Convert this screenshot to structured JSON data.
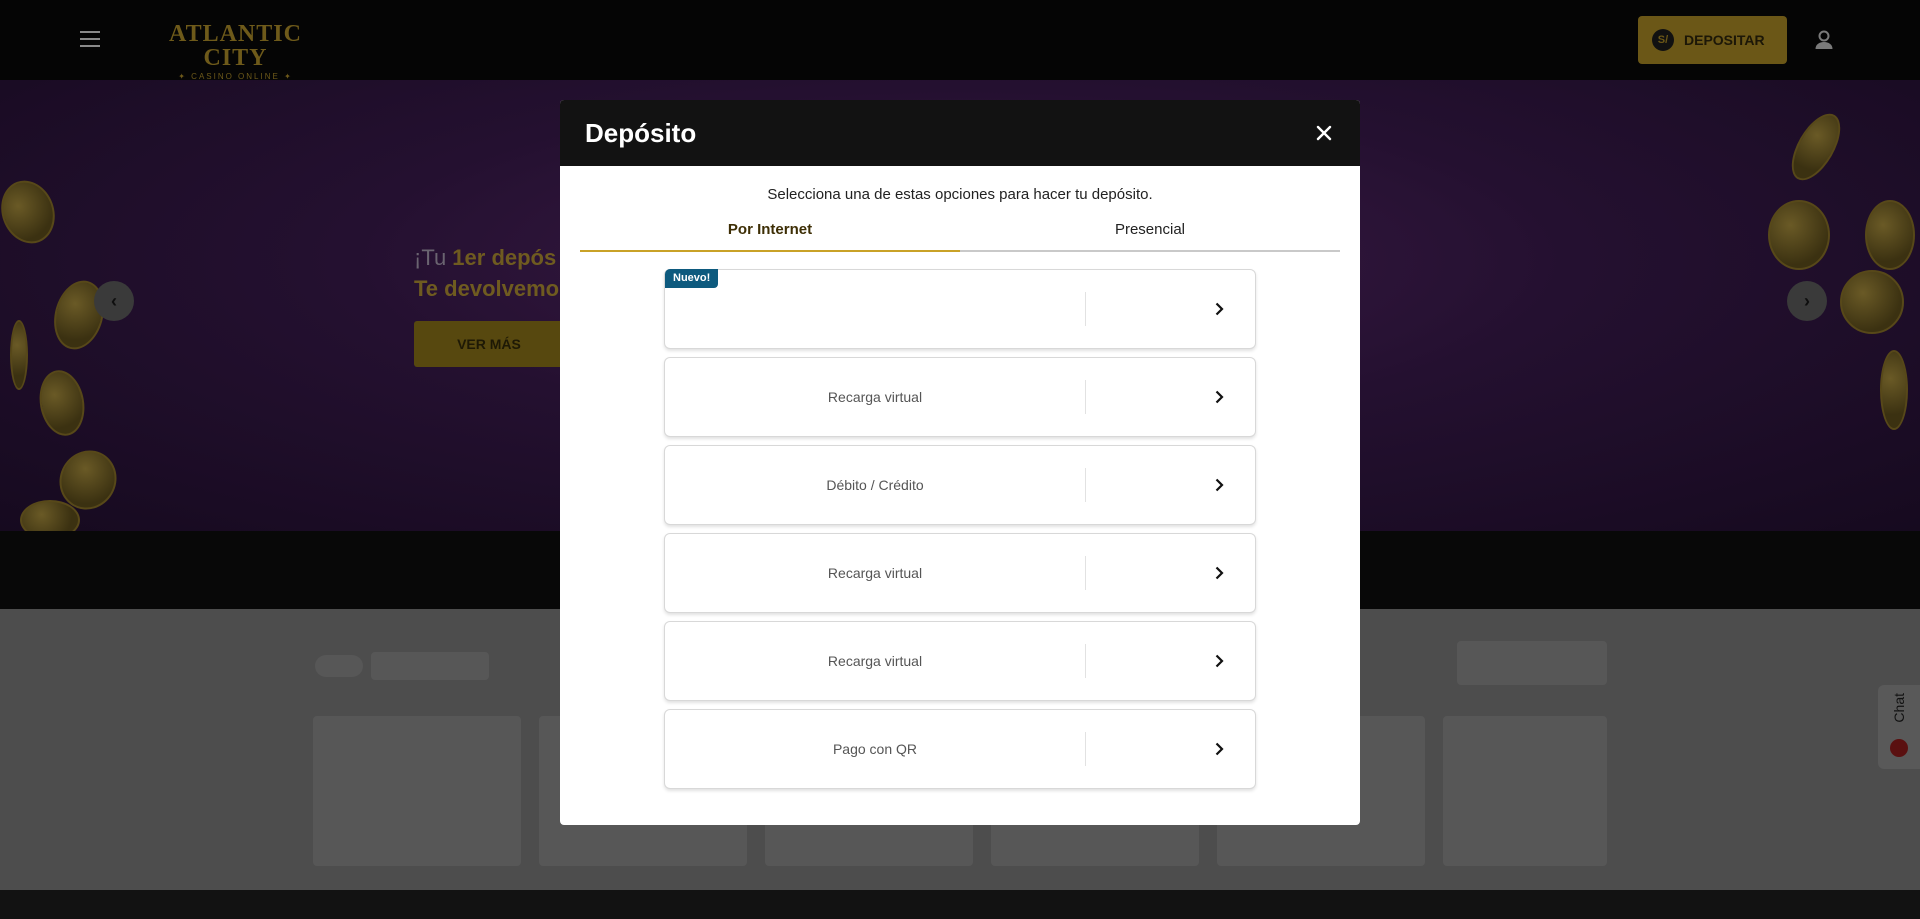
{
  "header": {
    "logo_main": "ATLANTIC CITY",
    "logo_sub": "✦ CASINO ONLINE ✦",
    "deposit_button": "DEPOSITAR",
    "deposit_coin_symbol": "S/"
  },
  "banner": {
    "title_light": "¡Tu ",
    "title_bold": "1er depós",
    "title_line2": "Te devolvemo",
    "cta": "VER MÁS"
  },
  "modal": {
    "title": "Depósito",
    "subtitle": "Selecciona una de estas opciones para hacer tu depósito.",
    "tabs": [
      {
        "label": "Por Internet",
        "active": true
      },
      {
        "label": "Presencial",
        "active": false
      }
    ],
    "options": [
      {
        "label": "",
        "badge": "Nuevo!"
      },
      {
        "label": "Recarga virtual"
      },
      {
        "label": "Débito / Crédito"
      },
      {
        "label": "Recarga virtual"
      },
      {
        "label": "Recarga virtual"
      },
      {
        "label": "Pago con QR"
      }
    ]
  },
  "chat": {
    "label": "Chat"
  },
  "colors": {
    "accent_gold": "#c9a227",
    "badge_blue": "#0d5a7e",
    "modal_header": "#121212"
  }
}
